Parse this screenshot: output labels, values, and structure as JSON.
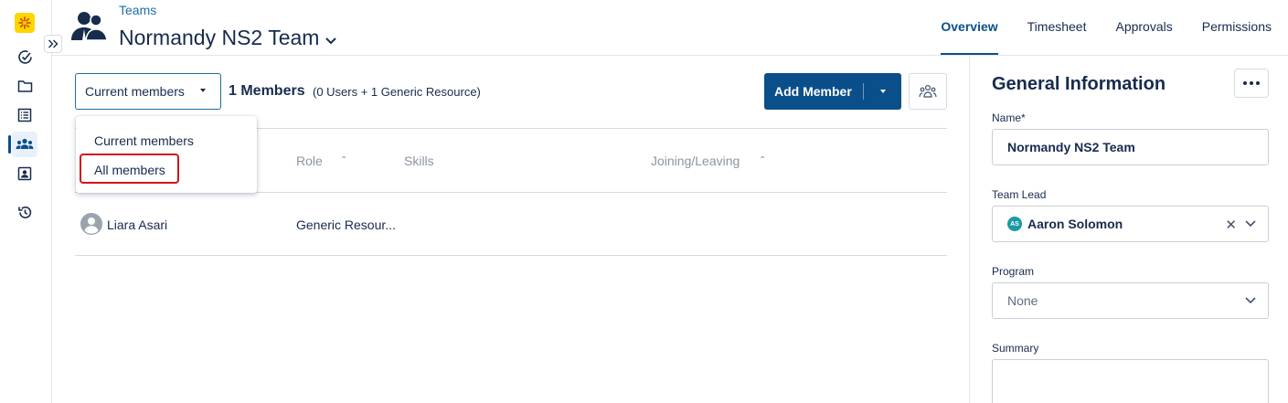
{
  "header": {
    "breadcrumb": "Teams",
    "title": "Normandy NS2 Team",
    "tabs": [
      "Overview",
      "Timesheet",
      "Approvals",
      "Permissions"
    ],
    "active_tab": "Overview"
  },
  "toolbar": {
    "filter_value": "Current members",
    "member_count": "1 Members",
    "member_breakdown": "(0 Users + 1 Generic Resource)",
    "add_member_label": "Add Member"
  },
  "dropdown": {
    "options": [
      "Current members",
      "All members"
    ],
    "highlighted": "All members"
  },
  "table": {
    "columns": [
      "Role",
      "Skills",
      "Joining/Leaving"
    ],
    "rows": [
      {
        "name": "Liara Asari",
        "role": "Generic Resour..."
      }
    ]
  },
  "panel": {
    "title": "General Information",
    "name_label": "Name*",
    "name_value": "Normandy NS2 Team",
    "lead_label": "Team Lead",
    "lead_initials": "AS",
    "lead_value": "Aaron Solomon",
    "program_label": "Program",
    "program_value": "None",
    "summary_label": "Summary"
  },
  "colors": {
    "accent": "#0b4f8a",
    "link": "#1b6ea8",
    "highlight_border": "#d0161b",
    "logo": "#ffd500"
  }
}
